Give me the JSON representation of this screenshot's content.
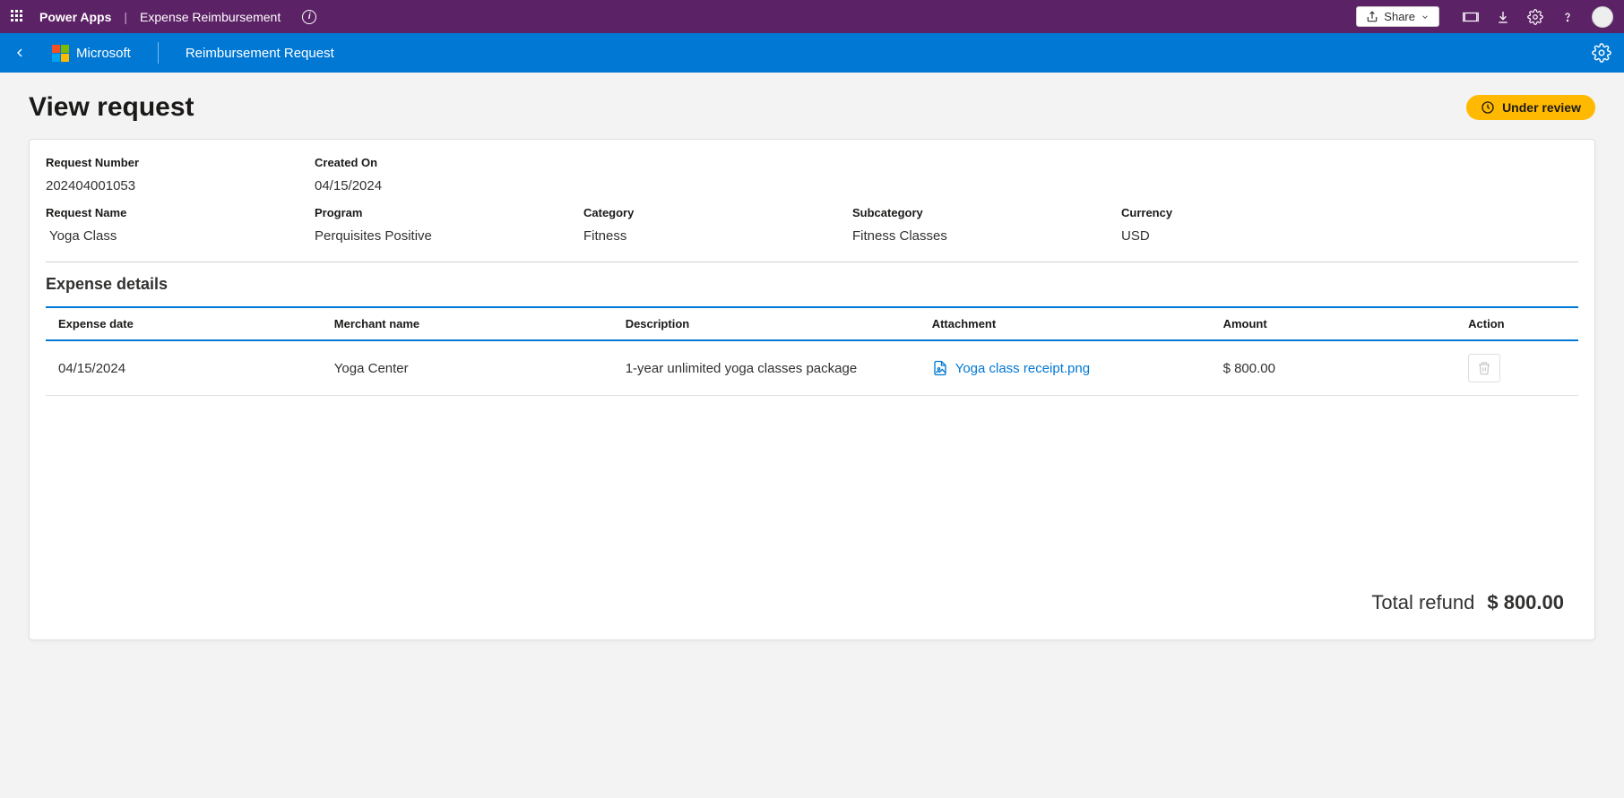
{
  "topHeader": {
    "brand": "Power Apps",
    "appName": "Expense Reimbursement",
    "shareLabel": "Share"
  },
  "appBar": {
    "orgName": "Microsoft",
    "pageName": "Reimbursement Request"
  },
  "page": {
    "title": "View request",
    "statusLabel": "Under review"
  },
  "fields": {
    "requestNumber": {
      "label": "Request Number",
      "value": "202404001053"
    },
    "createdOn": {
      "label": "Created On",
      "value": "04/15/2024"
    },
    "requestName": {
      "label": "Request Name",
      "value": "Yoga Class"
    },
    "program": {
      "label": "Program",
      "value": "Perquisites Positive"
    },
    "category": {
      "label": "Category",
      "value": "Fitness"
    },
    "subcategory": {
      "label": "Subcategory",
      "value": "Fitness Classes"
    },
    "currency": {
      "label": "Currency",
      "value": "USD"
    }
  },
  "expenseSection": {
    "title": "Expense details",
    "headers": {
      "date": "Expense date",
      "merchant": "Merchant name",
      "description": "Description",
      "attachment": "Attachment",
      "amount": "Amount",
      "action": "Action"
    },
    "rows": [
      {
        "date": "04/15/2024",
        "merchant": "Yoga Center",
        "description": "1-year unlimited yoga classes package",
        "attachment": "Yoga class receipt.png",
        "amount": "$ 800.00"
      }
    ],
    "totalLabel": "Total refund",
    "totalAmount": "$ 800.00"
  }
}
